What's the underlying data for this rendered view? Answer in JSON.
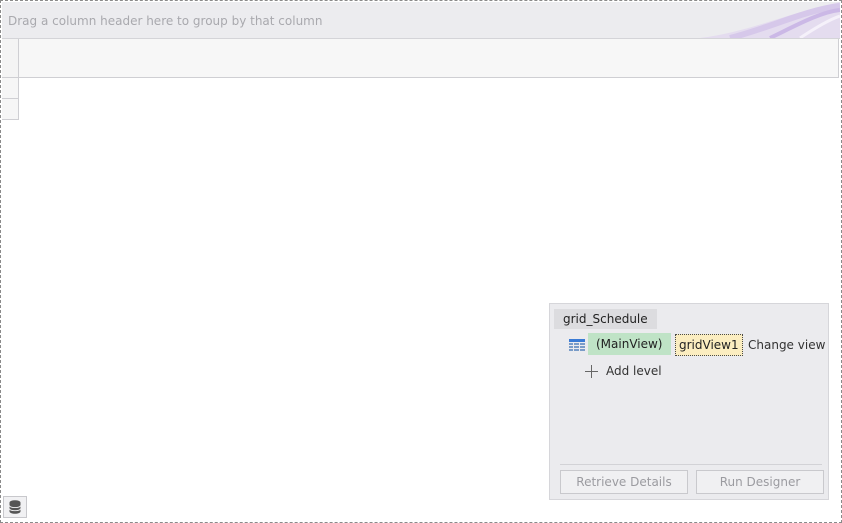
{
  "group_panel": {
    "hint": "Drag a column header here to group by that column"
  },
  "level_designer": {
    "grid_name": "grid_Schedule",
    "main_view_label": "(MainView)",
    "view_name": "gridView1",
    "change_view_label": "Change view",
    "add_level_label": "Add level",
    "retrieve_details_label": "Retrieve Details",
    "run_designer_label": "Run Designer"
  },
  "icons": {
    "view_icon": "grid-view-icon",
    "add_icon": "plus-icon",
    "data_source_icon": "database-icon"
  },
  "colors": {
    "main_view_highlight": "#bfe3c6",
    "view_name_highlight": "#fbedc0",
    "panel_background": "#ebebee"
  }
}
